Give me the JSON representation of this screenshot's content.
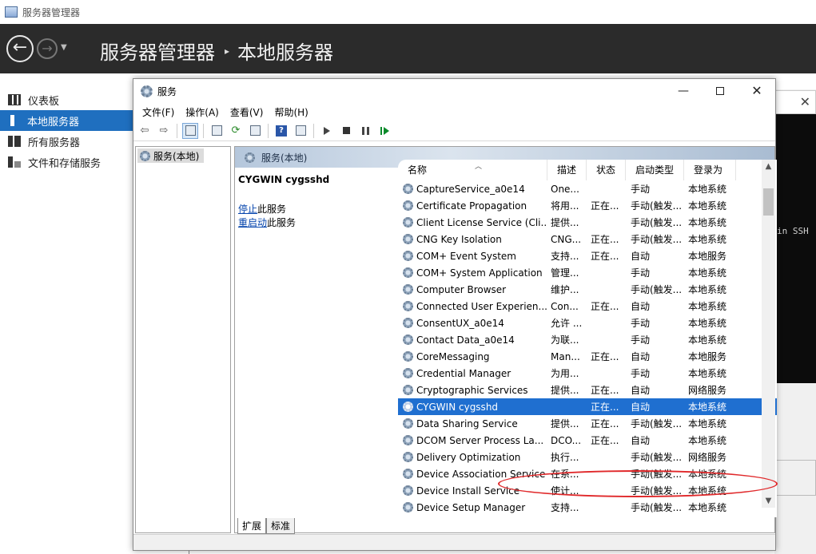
{
  "server_manager": {
    "window_title": "服务器管理器",
    "breadcrumb_root": "服务器管理器",
    "breadcrumb_sep": "▸",
    "breadcrumb_current": "本地服务器",
    "sidebar": [
      {
        "label": "仪表板",
        "icon": "dashboard-icon"
      },
      {
        "label": "本地服务器",
        "icon": "server-icon"
      },
      {
        "label": "所有服务器",
        "icon": "servers-icon"
      },
      {
        "label": "文件和存储服务",
        "icon": "storage-icon"
      }
    ],
    "console_text": "in SSH"
  },
  "services": {
    "title": "服务",
    "menu": [
      "文件(F)",
      "操作(A)",
      "查看(V)",
      "帮助(H)"
    ],
    "tree_item": "服务(本地)",
    "pane_header": "服务(本地)",
    "selected_service": "CYGWIN cygsshd",
    "stop_link": "停止",
    "stop_suffix": "此服务",
    "restart_link": "重启动",
    "restart_suffix": "此服务",
    "columns": {
      "name": "名称",
      "desc": "描述",
      "status": "状态",
      "startup": "启动类型",
      "logon": "登录为"
    },
    "tabs": {
      "extended": "扩展",
      "standard": "标准"
    },
    "rows": [
      {
        "name": "CaptureService_a0e14",
        "desc": "One...",
        "status": "",
        "startup": "手动",
        "logon": "本地系统"
      },
      {
        "name": "Certificate Propagation",
        "desc": "将用...",
        "status": "正在...",
        "startup": "手动(触发...",
        "logon": "本地系统"
      },
      {
        "name": "Client License Service (Cli...",
        "desc": "提供...",
        "status": "",
        "startup": "手动(触发...",
        "logon": "本地系统"
      },
      {
        "name": "CNG Key Isolation",
        "desc": "CNG...",
        "status": "正在...",
        "startup": "手动(触发...",
        "logon": "本地系统"
      },
      {
        "name": "COM+ Event System",
        "desc": "支持...",
        "status": "正在...",
        "startup": "自动",
        "logon": "本地服务"
      },
      {
        "name": "COM+ System Application",
        "desc": "管理...",
        "status": "",
        "startup": "手动",
        "logon": "本地系统"
      },
      {
        "name": "Computer Browser",
        "desc": "维护...",
        "status": "",
        "startup": "手动(触发...",
        "logon": "本地系统"
      },
      {
        "name": "Connected User Experien...",
        "desc": "Con...",
        "status": "正在...",
        "startup": "自动",
        "logon": "本地系统"
      },
      {
        "name": "ConsentUX_a0e14",
        "desc": "允许 ...",
        "status": "",
        "startup": "手动",
        "logon": "本地系统"
      },
      {
        "name": "Contact Data_a0e14",
        "desc": "为联...",
        "status": "",
        "startup": "手动",
        "logon": "本地系统"
      },
      {
        "name": "CoreMessaging",
        "desc": "Man...",
        "status": "正在...",
        "startup": "自动",
        "logon": "本地服务"
      },
      {
        "name": "Credential Manager",
        "desc": "为用...",
        "status": "",
        "startup": "手动",
        "logon": "本地系统"
      },
      {
        "name": "Cryptographic Services",
        "desc": "提供...",
        "status": "正在...",
        "startup": "自动",
        "logon": "网络服务"
      },
      {
        "name": "CYGWIN cygsshd",
        "desc": "",
        "status": "正在...",
        "startup": "自动",
        "logon": "本地系统"
      },
      {
        "name": "Data Sharing Service",
        "desc": "提供...",
        "status": "正在...",
        "startup": "手动(触发...",
        "logon": "本地系统"
      },
      {
        "name": "DCOM Server Process La...",
        "desc": "DCO...",
        "status": "正在...",
        "startup": "自动",
        "logon": "本地系统"
      },
      {
        "name": "Delivery Optimization",
        "desc": "执行...",
        "status": "",
        "startup": "手动(触发...",
        "logon": "网络服务"
      },
      {
        "name": "Device Association Service",
        "desc": "在系...",
        "status": "",
        "startup": "手动(触发...",
        "logon": "本地系统"
      },
      {
        "name": "Device Install Service",
        "desc": "使计...",
        "status": "",
        "startup": "手动(触发...",
        "logon": "本地系统"
      },
      {
        "name": "Device Setup Manager",
        "desc": "支持...",
        "status": "",
        "startup": "手动(触发...",
        "logon": "本地系统"
      }
    ],
    "selected_index": 13
  },
  "colors": {
    "accent": "#1f6fbf",
    "selection": "#1f6fd0",
    "highlight_ellipse": "#e0282a"
  }
}
